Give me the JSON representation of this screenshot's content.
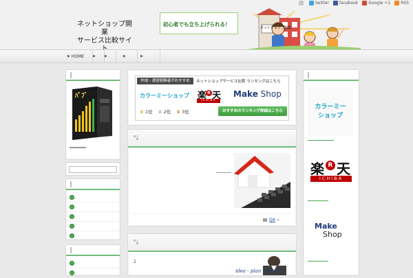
{
  "header": {
    "title_line1": "ネットショップ開業",
    "title_line2": "サービス比較サイト",
    "toplinks": [
      {
        "label": "",
        "icon": "home-icon",
        "color": "#c9c9c9"
      },
      {
        "label": "twitter",
        "icon": "twitter-icon",
        "color": "#3ea6d8"
      },
      {
        "label": "facebook",
        "icon": "facebook-icon",
        "color": "#3b5998"
      },
      {
        "label": "Google +1",
        "icon": "google-plus-icon",
        "color": "#d34836"
      },
      {
        "label": "RSS",
        "icon": "rss-icon",
        "color": "#f08a24"
      }
    ],
    "banner_text": "初心者でも立ち上げられる！",
    "banner_sign": "ネットショップ開業"
  },
  "nav": {
    "items": [
      {
        "label": "HOME"
      },
      {
        "label": ""
      },
      {
        "label": ""
      },
      {
        "label": ""
      },
      {
        "label": ""
      }
    ]
  },
  "left": {
    "product_caption": "",
    "box1_title": "",
    "box2_title": "",
    "list_items": [
      "",
      "",
      "",
      "",
      ""
    ],
    "box3_title": "",
    "list2_items": [
      "",
      ""
    ]
  },
  "center": {
    "ranking": {
      "label_left": "作成・運営経験者がおすすめ",
      "label_right": "ネットショップサービス比較 ランキングはこちら",
      "brand1": "カラーミーショップ",
      "brand2_top": "楽",
      "brand2_mid": "R",
      "brand2_right": "天",
      "brand2_sub": "ICHIBA",
      "brand3_a": "Make",
      "brand3_b": "Shop",
      "rank1": "1位",
      "rank2": "2位",
      "rank3": "3位",
      "cta": "おすすめのランキング詳細はこちら"
    },
    "post1": {
      "title": "",
      "excerpt": "",
      "tag": "QA"
    },
    "post2": {
      "title": "",
      "number": "1",
      "image_text": "idea - plan - action"
    }
  },
  "right": {
    "box_title": "",
    "ad1_line1": "カラーミー",
    "ad1_line2": "ショップ",
    "ad2_top": "楽",
    "ad2_mid": "R",
    "ad2_right": "天",
    "ad2_sub": "ICHIBA",
    "ad3_line1": "Make",
    "ad3_line2": "Shop"
  },
  "colors": {
    "accent_green": "#6fbb7d",
    "rakuten_red": "#bf0000",
    "colorme_cyan": "#1aa6c9",
    "makeshop_navy": "#1f3c7a"
  }
}
